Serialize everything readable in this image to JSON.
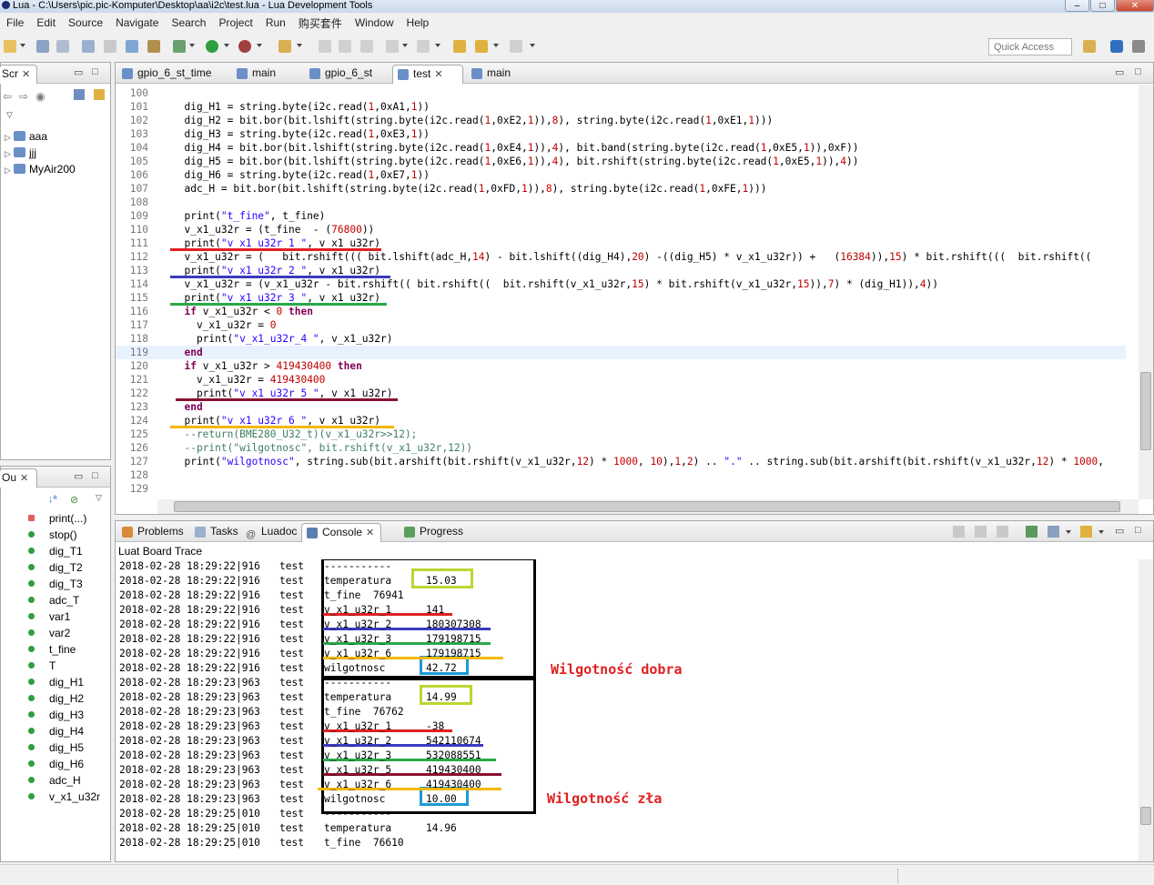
{
  "window": {
    "title": "Lua - C:\\Users\\pic.pic-Komputer\\Desktop\\aa\\i2c\\test.lua - Lua Development Tools"
  },
  "menu": [
    "File",
    "Edit",
    "Source",
    "Navigate",
    "Search",
    "Project",
    "Run",
    "购买套件",
    "Window",
    "Help"
  ],
  "quick_access": {
    "placeholder": "Quick Access"
  },
  "explorer": {
    "tab": "Scr",
    "items": [
      {
        "label": "aaa"
      },
      {
        "label": "jjj"
      },
      {
        "label": "MyAir200"
      }
    ]
  },
  "outline": {
    "tab": "Ou",
    "items": [
      "print(...)",
      "stop()",
      "dig_T1",
      "dig_T2",
      "dig_T3",
      "adc_T",
      "var1",
      "var2",
      "t_fine",
      "T",
      "dig_H1",
      "dig_H2",
      "dig_H3",
      "dig_H4",
      "dig_H5",
      "dig_H6",
      "adc_H",
      "v_x1_u32r"
    ]
  },
  "editor": {
    "tabs": [
      {
        "label": "gpio_6_st_time"
      },
      {
        "label": "main"
      },
      {
        "label": "gpio_6_st"
      },
      {
        "label": "test",
        "active": true
      },
      {
        "label": "main"
      }
    ],
    "lines": [
      {
        "n": "100",
        "t": ""
      },
      {
        "n": "101",
        "t": "  dig_H1 = string.byte(i2c.read(1,0xA1,1))"
      },
      {
        "n": "102",
        "t": "  dig_H2 = bit.bor(bit.lshift(string.byte(i2c.read(1,0xE2,1)),8), string.byte(i2c.read(1,0xE1,1)))"
      },
      {
        "n": "103",
        "t": "  dig_H3 = string.byte(i2c.read(1,0xE3,1))"
      },
      {
        "n": "104",
        "t": "  dig_H4 = bit.bor(bit.lshift(string.byte(i2c.read(1,0xE4,1)),4), bit.band(string.byte(i2c.read(1,0xE5,1)),0xF))"
      },
      {
        "n": "105",
        "t": "  dig_H5 = bit.bor(bit.lshift(string.byte(i2c.read(1,0xE6,1)),4), bit.rshift(string.byte(i2c.read(1,0xE5,1)),4))"
      },
      {
        "n": "106",
        "t": "  dig_H6 = string.byte(i2c.read(1,0xE7,1))"
      },
      {
        "n": "107",
        "t": "  adc_H = bit.bor(bit.lshift(string.byte(i2c.read(1,0xFD,1)),8), string.byte(i2c.read(1,0xFE,1)))"
      },
      {
        "n": "108",
        "t": ""
      },
      {
        "n": "109",
        "t": "  print(\"t_fine\", t_fine)"
      },
      {
        "n": "110",
        "t": "  v_x1_u32r = (t_fine  - (76800))"
      },
      {
        "n": "111",
        "t": "  print(\"v_x1_u32r_1 \", v_x1_u32r)"
      },
      {
        "n": "112",
        "t": "  v_x1_u32r = (   bit.rshift((( bit.lshift(adc_H,14) - bit.lshift((dig_H4),20) -((dig_H5) * v_x1_u32r)) +   (16384)),15) * bit.rshift(((  bit.rshift(("
      },
      {
        "n": "113",
        "t": "  print(\"v_x1_u32r_2 \", v_x1_u32r)"
      },
      {
        "n": "114",
        "t": "  v_x1_u32r = (v_x1_u32r - bit.rshift(( bit.rshift((  bit.rshift(v_x1_u32r,15) * bit.rshift(v_x1_u32r,15)),7) * (dig_H1)),4))"
      },
      {
        "n": "115",
        "t": "  print(\"v_x1_u32r_3 \", v_x1_u32r)"
      },
      {
        "n": "116",
        "t": "  if v_x1_u32r < 0 then"
      },
      {
        "n": "117",
        "t": "    v_x1_u32r = 0"
      },
      {
        "n": "118",
        "t": "    print(\"v_x1_u32r_4 \", v_x1_u32r)"
      },
      {
        "n": "119",
        "t": "  end"
      },
      {
        "n": "120",
        "t": "  if v_x1_u32r > 419430400 then"
      },
      {
        "n": "121",
        "t": "    v_x1_u32r = 419430400"
      },
      {
        "n": "122",
        "t": "    print(\"v_x1_u32r_5 \", v_x1_u32r)"
      },
      {
        "n": "123",
        "t": "  end"
      },
      {
        "n": "124",
        "t": "  print(\"v_x1_u32r_6 \", v_x1_u32r)"
      },
      {
        "n": "125",
        "t": "  --return(BME280_U32_t)(v_x1_u32r>>12);"
      },
      {
        "n": "126",
        "t": "  --print(\"wilgotnosc\", bit.rshift(v_x1_u32r,12))"
      },
      {
        "n": "127",
        "t": "  print(\"wilgotnosc\", string.sub(bit.arshift(bit.rshift(v_x1_u32r,12) * 1000, 10),1,2) .. \".\" .. string.sub(bit.arshift(bit.rshift(v_x1_u32r,12) * 1000,"
      },
      {
        "n": "128",
        "t": ""
      },
      {
        "n": "129",
        "t": ""
      }
    ]
  },
  "bottom": {
    "tabs": [
      "Problems",
      "Tasks",
      "Luadoc",
      "Console",
      "Progress"
    ],
    "console_title": "Luat Board Trace",
    "lines": [
      {
        "ts": "2018-02-28 18:29:22|916",
        "tag": "test",
        "label": "-----------",
        "value": ""
      },
      {
        "ts": "2018-02-28 18:29:22|916",
        "tag": "test",
        "label": "temperatura",
        "value": "15.03"
      },
      {
        "ts": "2018-02-28 18:29:22|916",
        "tag": "test",
        "label": "t_fine  76941",
        "value": ""
      },
      {
        "ts": "2018-02-28 18:29:22|916",
        "tag": "test",
        "label": "v_x1_u32r_1",
        "value": "141"
      },
      {
        "ts": "2018-02-28 18:29:22|916",
        "tag": "test",
        "label": "v_x1_u32r_2",
        "value": "180307308"
      },
      {
        "ts": "2018-02-28 18:29:22|916",
        "tag": "test",
        "label": "v_x1_u32r_3",
        "value": "179198715"
      },
      {
        "ts": "2018-02-28 18:29:22|916",
        "tag": "test",
        "label": "v_x1_u32r_6",
        "value": "179198715"
      },
      {
        "ts": "2018-02-28 18:29:22|916",
        "tag": "test",
        "label": "wilgotnosc",
        "value": "42.72"
      },
      {
        "ts": "2018-02-28 18:29:23|963",
        "tag": "test",
        "label": "-----------",
        "value": ""
      },
      {
        "ts": "2018-02-28 18:29:23|963",
        "tag": "test",
        "label": "temperatura",
        "value": "14.99"
      },
      {
        "ts": "2018-02-28 18:29:23|963",
        "tag": "test",
        "label": "t_fine  76762",
        "value": ""
      },
      {
        "ts": "2018-02-28 18:29:23|963",
        "tag": "test",
        "label": "v_x1_u32r_1",
        "value": "-38"
      },
      {
        "ts": "2018-02-28 18:29:23|963",
        "tag": "test",
        "label": "v_x1_u32r_2",
        "value": "542110674"
      },
      {
        "ts": "2018-02-28 18:29:23|963",
        "tag": "test",
        "label": "v_x1_u32r_3",
        "value": "532088551"
      },
      {
        "ts": "2018-02-28 18:29:23|963",
        "tag": "test",
        "label": "v_x1_u32r_5",
        "value": "419430400"
      },
      {
        "ts": "2018-02-28 18:29:23|963",
        "tag": "test",
        "label": "v_x1_u32r_6",
        "value": "419430400"
      },
      {
        "ts": "2018-02-28 18:29:23|963",
        "tag": "test",
        "label": "wilgotnosc",
        "value": "10.00"
      },
      {
        "ts": "2018-02-28 18:29:25|010",
        "tag": "test",
        "label": "-----------",
        "value": ""
      },
      {
        "ts": "2018-02-28 18:29:25|010",
        "tag": "test",
        "label": "temperatura",
        "value": "14.96"
      },
      {
        "ts": "2018-02-28 18:29:25|010",
        "tag": "test",
        "label": "t_fine  76610",
        "value": ""
      }
    ]
  },
  "annotations": {
    "good": "Wilgotność dobra",
    "bad": "Wilgotność zła"
  },
  "colors": {
    "red": "#e02020",
    "blue": "#3a3ac0",
    "green": "#2aa84a",
    "maroon": "#8b1030",
    "yellow": "#f2b800",
    "lime": "#b8d832",
    "cyan": "#1e9ad6"
  }
}
